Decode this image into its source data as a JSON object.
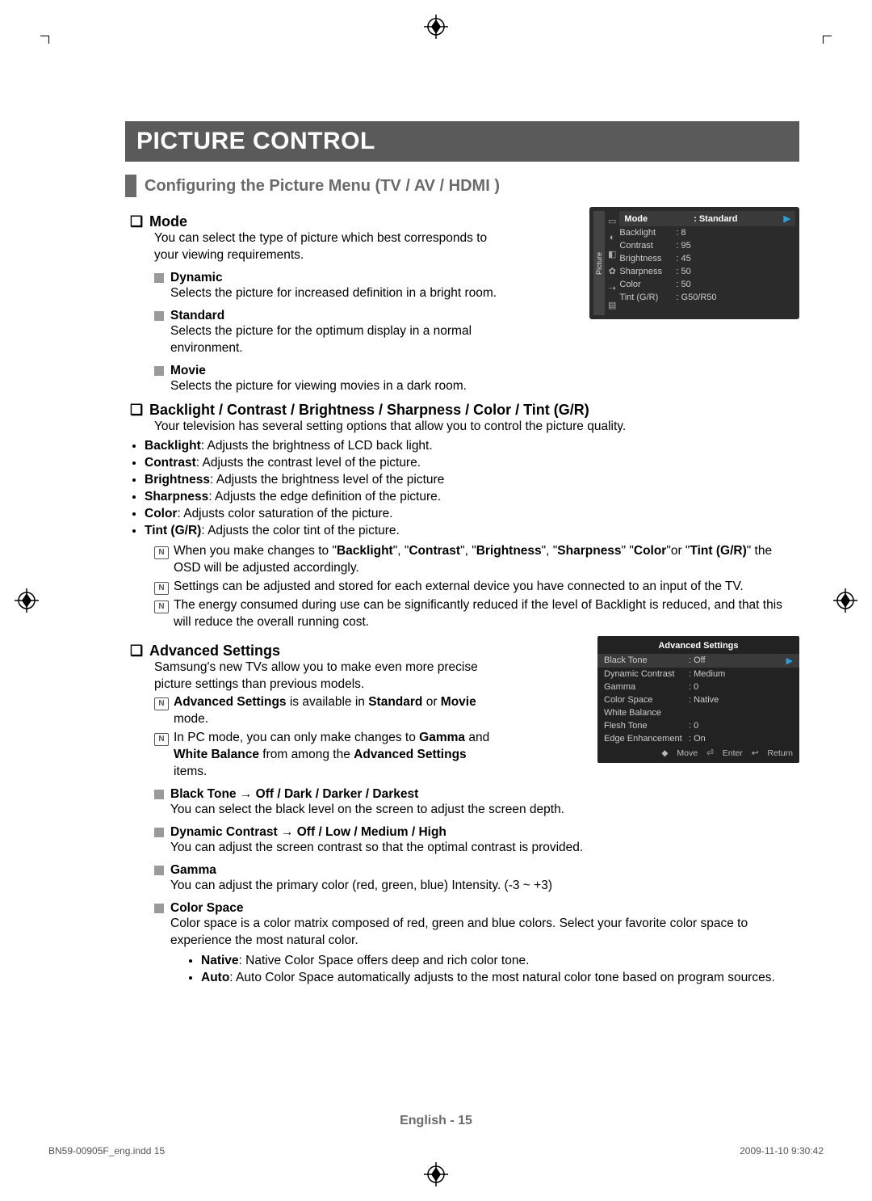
{
  "title": "PICTURE CONTROL",
  "section1": "Configuring the Picture Menu (TV / AV / HDMI )",
  "mode": {
    "head": "Mode",
    "intro": "You can select the type of picture which best corresponds to your viewing requirements.",
    "dynamic": {
      "h": "Dynamic",
      "p": "Selects the picture for increased definition in a bright room."
    },
    "standard": {
      "h": "Standard",
      "p": "Selects the picture for the optimum display in a normal environment."
    },
    "movie": {
      "h": "Movie",
      "p": "Selects the picture for viewing movies in a dark room."
    }
  },
  "params": {
    "head": "Backlight / Contrast / Brightness / Sharpness / Color / Tint (G/R)",
    "intro": "Your television has several setting options that allow you to control the picture quality.",
    "bullets": [
      {
        "b": "Backlight",
        "t": ": Adjusts the brightness of LCD back light."
      },
      {
        "b": "Contrast",
        "t": ": Adjusts the contrast level of the picture."
      },
      {
        "b": "Brightness",
        "t": ": Adjusts the brightness level of the picture"
      },
      {
        "b": "Sharpness",
        "t": ": Adjusts the edge definition of the picture."
      },
      {
        "b": "Color",
        "t": ": Adjusts color saturation of the picture."
      },
      {
        "b": "Tint (G/R)",
        "t": ": Adjusts the color tint of the picture."
      }
    ],
    "note1a": "When you make changes to \"",
    "note1b": "Backlight",
    "note1c": "\", \"",
    "note1d": "Contrast",
    "note1e": "\", \"",
    "note1f": "Brightness",
    "note1g": "\", \"",
    "note1h": "Sharpness",
    "note1i": "\" \"",
    "note1j": "Color",
    "note1k": "\"or \"",
    "note1l": "Tint (G/R)",
    "note1m": "\" the OSD will be adjusted accordingly.",
    "note2": "Settings can be adjusted and stored for each external device you have connected to an input of the TV.",
    "note3": "The energy consumed during use can be significantly reduced if the level of Backlight is reduced, and that this will reduce the overall running cost."
  },
  "adv": {
    "head": "Advanced Settings",
    "intro": "Samsung's new TVs allow you to make even more precise picture settings than previous models.",
    "n1a": "Advanced Settings",
    "n1b": " is available in ",
    "n1c": "Standard",
    "n1d": " or ",
    "n1e": "Movie",
    "n1f": " mode.",
    "n2a": "In PC mode, you can only make changes to ",
    "n2b": "Gamma",
    "n2c": " and ",
    "n2d": "White Balance",
    "n2e": " from among the ",
    "n2f": "Advanced Settings",
    "n2g": " items.",
    "items": {
      "blacktone": {
        "h": "Black Tone → Off / Dark / Darker / Darkest",
        "p": "You can select the black level on the screen to adjust the screen depth."
      },
      "dyncon": {
        "h": "Dynamic Contrast → Off / Low / Medium / High",
        "p": "You can adjust the screen contrast so that the optimal contrast is provided."
      },
      "gamma": {
        "h": "Gamma",
        "p": "You can adjust the primary color (red, green, blue) Intensity. (-3 ~ +3)"
      },
      "cspace": {
        "h": "Color Space",
        "p": "Color space is a color matrix composed of red, green and blue colors. Select your favorite color space to experience the most natural color."
      },
      "cspace_b": [
        {
          "b": "Native",
          "t": ": Native Color Space offers deep and rich color tone."
        },
        {
          "b": "Auto",
          "t": ": Auto Color Space automatically adjusts to the most natural color tone based on program sources."
        }
      ]
    }
  },
  "osd1": {
    "vlabel": "Picture",
    "rows": [
      [
        "Mode",
        ": Standard"
      ],
      [
        "Backlight",
        ": 8"
      ],
      [
        "Contrast",
        ": 95"
      ],
      [
        "Brightness",
        ": 45"
      ],
      [
        "Sharpness",
        ": 50"
      ],
      [
        "Color",
        ": 50"
      ],
      [
        "Tint (G/R)",
        ": G50/R50"
      ]
    ]
  },
  "osd2": {
    "title": "Advanced Settings",
    "rows": [
      [
        "Black Tone",
        ": Off"
      ],
      [
        "Dynamic Contrast",
        ": Medium"
      ],
      [
        "Gamma",
        ": 0"
      ],
      [
        "Color Space",
        ": Native"
      ],
      [
        "White Balance",
        ""
      ],
      [
        "Flesh Tone",
        ": 0"
      ],
      [
        "Edge Enhancement",
        ": On"
      ]
    ],
    "foot": {
      "move": "Move",
      "enter": "Enter",
      "return": "Return"
    }
  },
  "footer": {
    "page": "English - 15",
    "file": "BN59-00905F_eng.indd   15",
    "ts": "2009-11-10   9:30:42"
  }
}
